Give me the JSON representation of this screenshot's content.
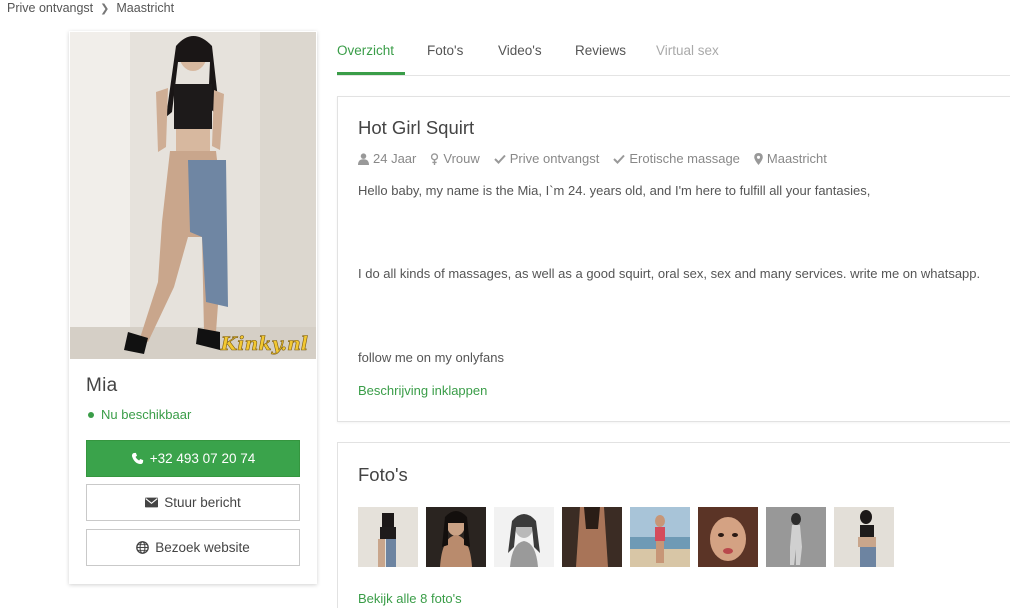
{
  "breadcrumb": {
    "items": [
      "Prive ontvangst",
      "Maastricht"
    ]
  },
  "profile": {
    "name": "Mia",
    "status": "Nu beschikbaar",
    "watermark": "Kinky.nl",
    "phone": "+32 493 07 20 74",
    "message_label": "Stuur bericht",
    "website_label": "Bezoek website"
  },
  "tabs": [
    "Overzicht",
    "Foto's",
    "Video's",
    "Reviews",
    "Virtual sex"
  ],
  "description": {
    "title": "Hot Girl Squirt",
    "meta": [
      "24 Jaar",
      "Vrouw",
      "Prive ontvangst",
      "Erotische massage",
      "Maastricht"
    ],
    "paragraphs": [
      "Hello baby, my name is the Mia, I`m 24. years old, and I'm here to fulfill all your fantasies,",
      "I do all kinds of massages, as well as a good squirt, oral sex, sex and many services. write me on whatsapp.",
      "follow me on my onlyfans"
    ],
    "collapse_label": "Beschrijving inklappen"
  },
  "photos": {
    "title": "Foto's",
    "count": 8,
    "link_label": "Bekijk alle 8 foto's"
  },
  "colors": {
    "accent": "#3a9d48",
    "button_green": "#3aa34b"
  }
}
